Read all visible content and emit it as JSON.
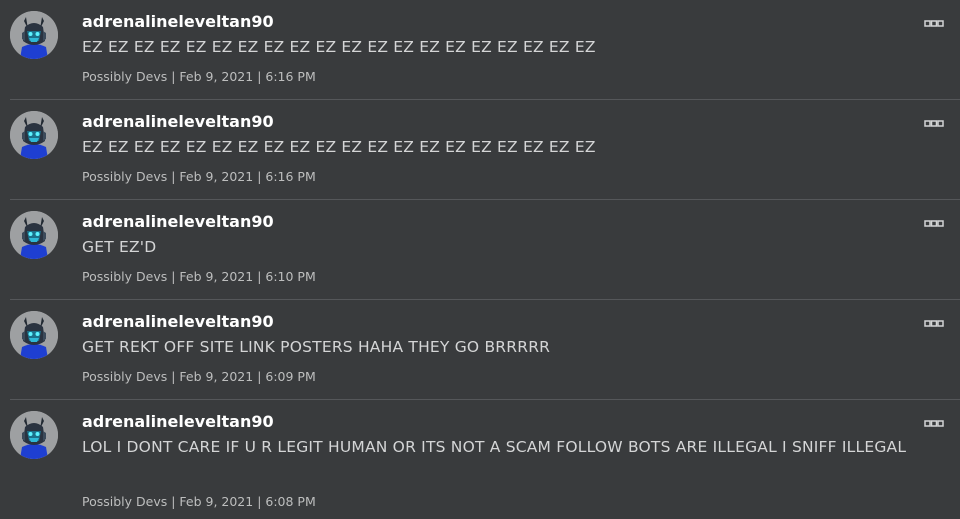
{
  "posts": [
    {
      "username": "adrenalineleveltan90",
      "message": "EZ EZ EZ EZ EZ EZ EZ EZ EZ EZ EZ EZ EZ EZ EZ EZ EZ EZ EZ EZ",
      "meta": "Possibly Devs | Feb 9, 2021 | 6:16 PM"
    },
    {
      "username": "adrenalineleveltan90",
      "message": "EZ EZ EZ EZ EZ EZ EZ EZ EZ EZ EZ EZ EZ EZ EZ EZ EZ EZ EZ EZ",
      "meta": "Possibly Devs | Feb 9, 2021 | 6:16 PM"
    },
    {
      "username": "adrenalineleveltan90",
      "message": "GET EZ'D",
      "meta": "Possibly Devs | Feb 9, 2021 | 6:10 PM"
    },
    {
      "username": "adrenalineleveltan90",
      "message": "GET REKT OFF SITE LINK POSTERS HAHA THEY GO BRRRRR",
      "meta": "Possibly Devs | Feb 9, 2021 | 6:09 PM"
    },
    {
      "username": "adrenalineleveltan90",
      "message": "LOL I DONT CARE IF U R LEGIT HUMAN OR ITS NOT A SCAM FOLLOW BOTS ARE ILLEGAL I SNIFF ILLEGAL",
      "meta": "Possibly Devs | Feb 9, 2021 | 6:08 PM"
    }
  ],
  "icons": {
    "avatar": "avatar-icon",
    "menu": "more-options-icon"
  },
  "colors": {
    "background": "#393b3d",
    "divider": "#55575a",
    "username": "#ffffff",
    "message": "#d4d5d6",
    "meta": "#bdbebe"
  }
}
